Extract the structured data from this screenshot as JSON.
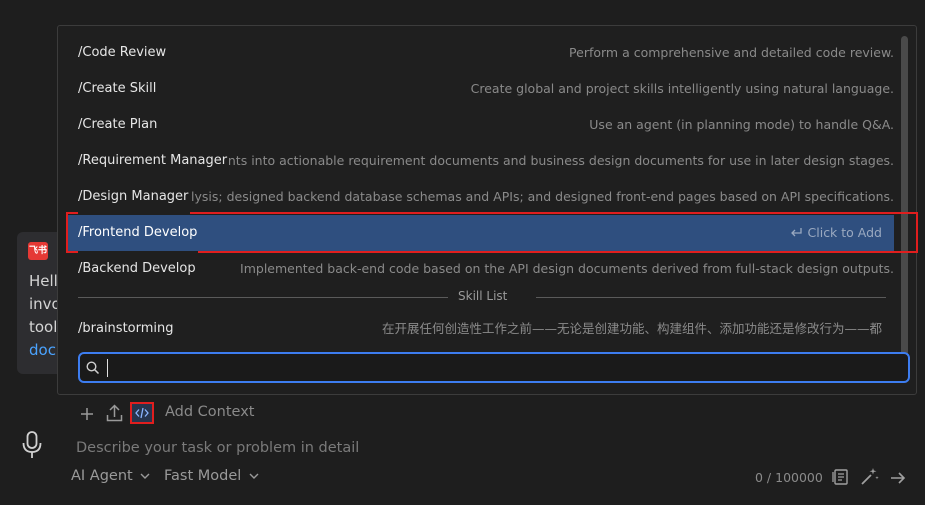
{
  "background_card": {
    "logo_text": "飞书",
    "lines": [
      "Hell",
      "invo",
      "tool",
      "docu"
    ]
  },
  "commands": [
    {
      "name": "/Code Review",
      "description": "Perform a comprehensive and detailed code review."
    },
    {
      "name": "/Create Skill",
      "description": "Create global and project skills intelligently using natural language."
    },
    {
      "name": "/Create Plan",
      "description": "Use an agent (in planning mode) to handle Q&A."
    },
    {
      "name": "/Requirement Manager",
      "description": "equirements into actionable requirement documents and business design documents for use in later design stages."
    },
    {
      "name": "/Design Manager",
      "description": "ents analysis; designed backend database schemas and APIs; and designed front-end pages based on API specifications."
    },
    {
      "name": "/Frontend Develop",
      "description": "Click to Add"
    },
    {
      "name": "/Backend Develop",
      "description": "Implemented back-end code based on the API design documents derived from full-stack design outputs."
    }
  ],
  "skill_list_label": "Skill List",
  "skills": [
    {
      "name": "/brainstorming",
      "description": "在开展任何创造性工作之前——无论是创建功能、构建组件、添加功能还是修改行为——都"
    }
  ],
  "search": {
    "value": "",
    "placeholder": ""
  },
  "toolbar": {
    "add_context": "Add Context"
  },
  "input": {
    "placeholder": "Describe your task or problem in detail"
  },
  "bottom": {
    "agent": "AI Agent",
    "model": "Fast Model",
    "counter": "0 / 100000"
  },
  "colors": {
    "accent": "#3d7df0",
    "highlight_row": "#2f4f7f",
    "annotation_red": "#e01e1e"
  }
}
